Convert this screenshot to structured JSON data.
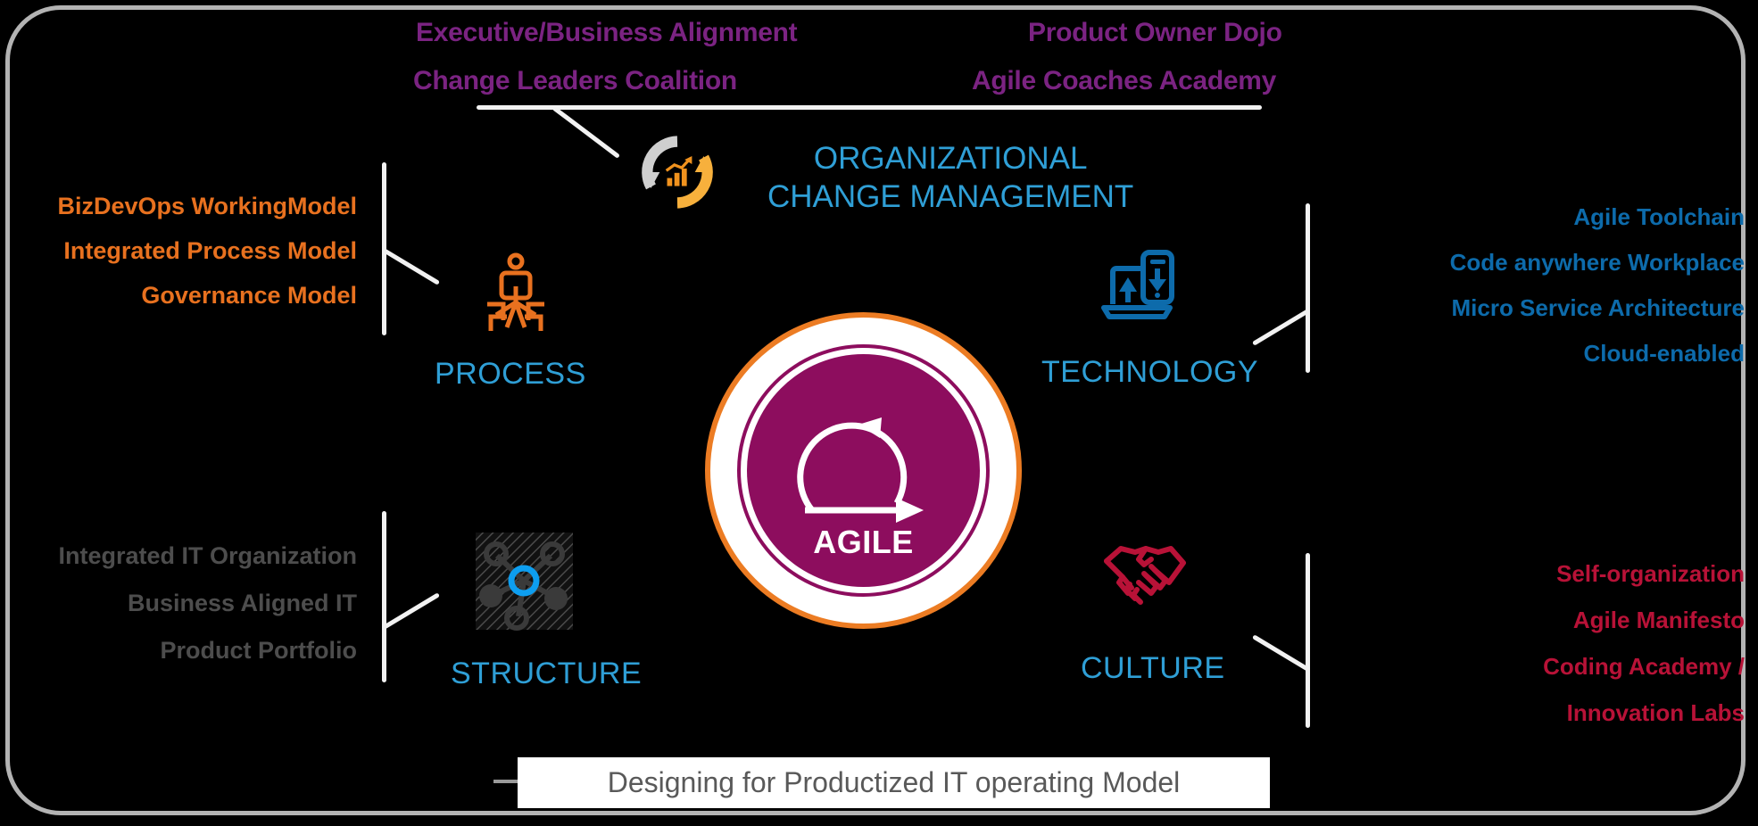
{
  "diagram": {
    "caption": "Designing for Productized IT operating Model",
    "center": {
      "label": "AGILE",
      "ring_color": "#ec7c23",
      "disc_color": "#8d0d5e"
    },
    "ocm": {
      "title_line1": "ORGANIZATIONAL",
      "title_line2": "CHANGE MANAGEMENT",
      "title_color": "#2f9fd6",
      "icon": "circular-change-arrow-chart-icon",
      "label_color": "#7b2382",
      "labels_left": [
        "Executive/Business Alignment",
        "Change Leaders Coalition"
      ],
      "labels_right": [
        "Product Owner Dojo",
        "Agile Coaches Academy"
      ]
    },
    "pillars": [
      {
        "key": "process",
        "title": "PROCESS",
        "title_color": "#2f9fd6",
        "icon": "person-branching-arrows-icon",
        "icon_color": "#e8711f",
        "item_color": "#e8711f",
        "items": [
          "BizDevOps WorkingModel",
          "Integrated  Process  Model",
          "Governance Model"
        ]
      },
      {
        "key": "technology",
        "title": "TECHNOLOGY",
        "title_color": "#2f9fd6",
        "icon": "laptop-phone-sync-icon",
        "icon_color": "#0d6bab",
        "item_color": "#0d6bab",
        "items": [
          "Agile Toolchain",
          "Code anywhere Workplace",
          "Micro Service Architecture",
          "Cloud-enabled"
        ]
      },
      {
        "key": "structure",
        "title": "STRUCTURE",
        "title_color": "#2f9fd6",
        "icon": "network-hub-nodes-icon",
        "icon_color": "#0d9ef0",
        "item_color": "#4d4d4d",
        "items": [
          "Integrated IT Organization",
          "Business Aligned IT",
          "Product Portfolio"
        ]
      },
      {
        "key": "culture",
        "title": "CULTURE",
        "title_color": "#2f9fd6",
        "icon": "handshake-icon",
        "icon_color": "#b81237",
        "item_color": "#b81237",
        "items": [
          "Self-organization",
          "Agile Manifesto",
          "Coding Academy /",
          "Innovation Labs"
        ]
      }
    ]
  }
}
